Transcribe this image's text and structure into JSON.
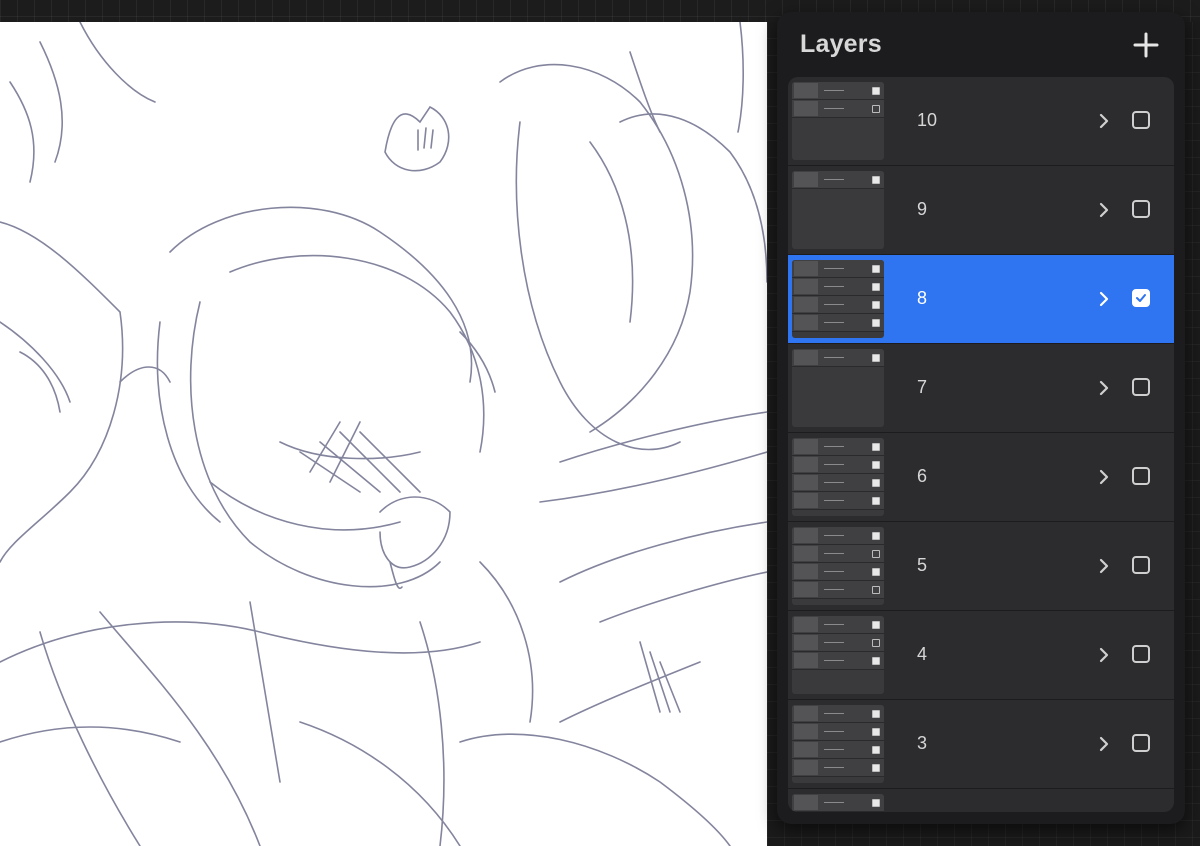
{
  "panel": {
    "title": "Layers",
    "add_icon": "plus-icon"
  },
  "groups": [
    {
      "name": "10",
      "selected": false,
      "visible": false,
      "thumbs": [
        {
          "on": true
        },
        {
          "on": false
        }
      ]
    },
    {
      "name": "9",
      "selected": false,
      "visible": false,
      "thumbs": [
        {
          "on": true
        }
      ]
    },
    {
      "name": "8",
      "selected": true,
      "visible": true,
      "thumbs": [
        {
          "on": true
        },
        {
          "on": true
        },
        {
          "on": true
        },
        {
          "on": true
        }
      ]
    },
    {
      "name": "7",
      "selected": false,
      "visible": false,
      "thumbs": [
        {
          "on": true
        }
      ]
    },
    {
      "name": "6",
      "selected": false,
      "visible": false,
      "thumbs": [
        {
          "on": true
        },
        {
          "on": true
        },
        {
          "on": true
        },
        {
          "on": true
        }
      ]
    },
    {
      "name": "5",
      "selected": false,
      "visible": false,
      "thumbs": [
        {
          "on": true
        },
        {
          "on": false
        },
        {
          "on": true
        },
        {
          "on": false
        }
      ]
    },
    {
      "name": "4",
      "selected": false,
      "visible": false,
      "thumbs": [
        {
          "on": true
        },
        {
          "on": false
        },
        {
          "on": true
        }
      ]
    },
    {
      "name": "3",
      "selected": false,
      "visible": false,
      "thumbs": [
        {
          "on": true
        },
        {
          "on": true
        },
        {
          "on": true
        },
        {
          "on": true
        }
      ]
    },
    {
      "name": "",
      "selected": false,
      "visible": false,
      "thumbs": [
        {
          "on": true
        }
      ]
    }
  ],
  "colors": {
    "selected": "#2f74f0",
    "row": "#2c2c2e",
    "panel": "#1c1c1e"
  }
}
